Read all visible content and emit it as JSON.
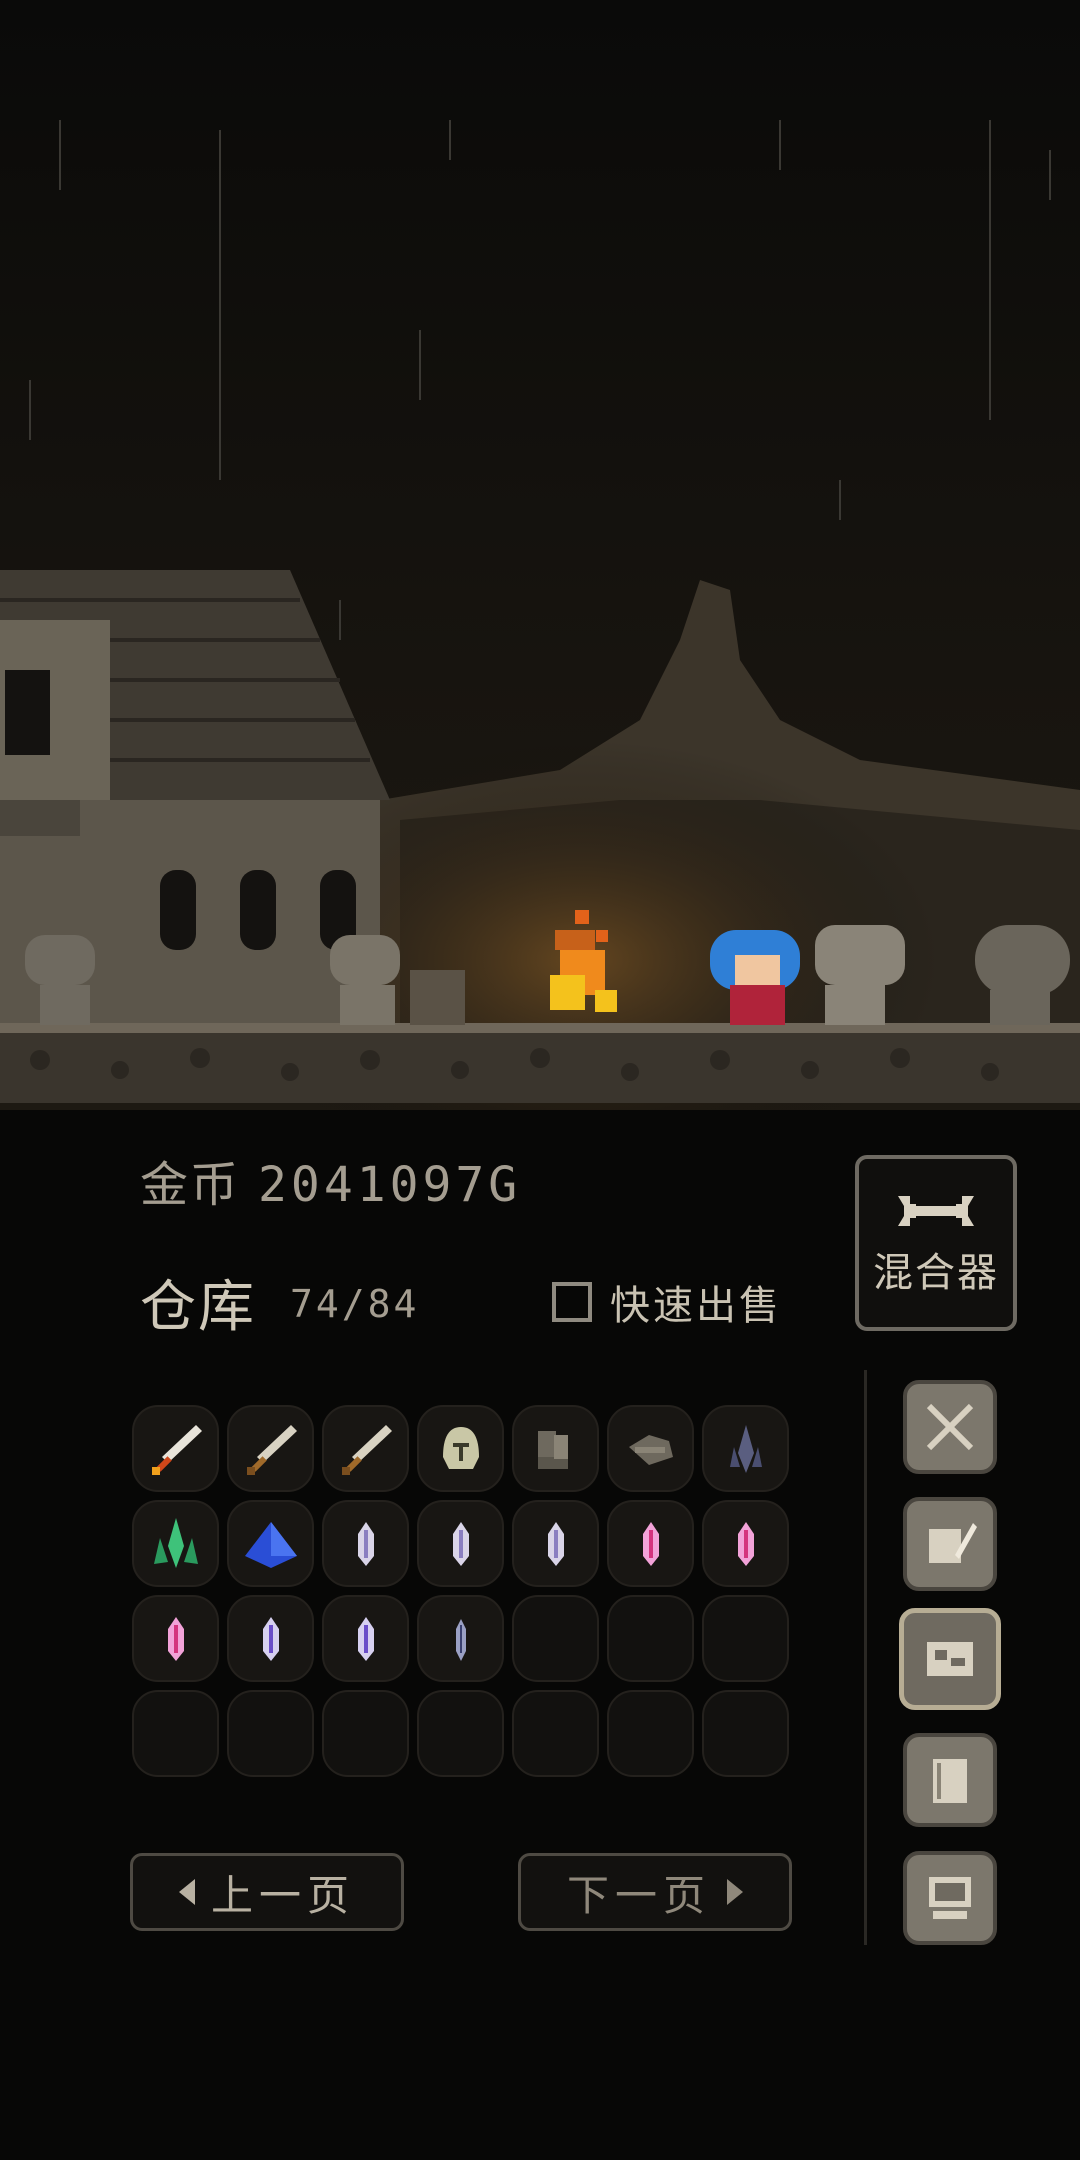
{
  "gold": {
    "label": "金币",
    "value": "2041097G"
  },
  "storage": {
    "label": "仓库",
    "count": "74/84"
  },
  "quick_sell": {
    "label": "快速出售",
    "checked": false
  },
  "mixer": {
    "label": "混合器",
    "icon": "wrench-icon"
  },
  "inventory": {
    "slots": [
      "sword-flame",
      "sword-bronze",
      "sword-bronze",
      "helmet",
      "boots",
      "glove",
      "crystal-dark",
      "crystal-green",
      "crystal-blue-large",
      "gem-white",
      "gem-white",
      "gem-white",
      "gem-pink",
      "gem-pink",
      "gem-pink",
      "gem-violet",
      "gem-violet",
      "gem-dark",
      "",
      "",
      "",
      "",
      "",
      "",
      "",
      "",
      "",
      ""
    ]
  },
  "side_menu": [
    {
      "icon": "crossed-swords-icon",
      "active": false
    },
    {
      "icon": "scroll-quill-icon",
      "active": false
    },
    {
      "icon": "map-icon",
      "active": true
    },
    {
      "icon": "book-icon",
      "active": false
    },
    {
      "icon": "computer-icon",
      "active": false
    }
  ],
  "pager": {
    "prev_label": "上一页",
    "next_label": "下一页"
  },
  "colors": {
    "fire": "#f08a1c",
    "hero_hair": "#2f7fd6",
    "panel_bg": "#070706"
  }
}
